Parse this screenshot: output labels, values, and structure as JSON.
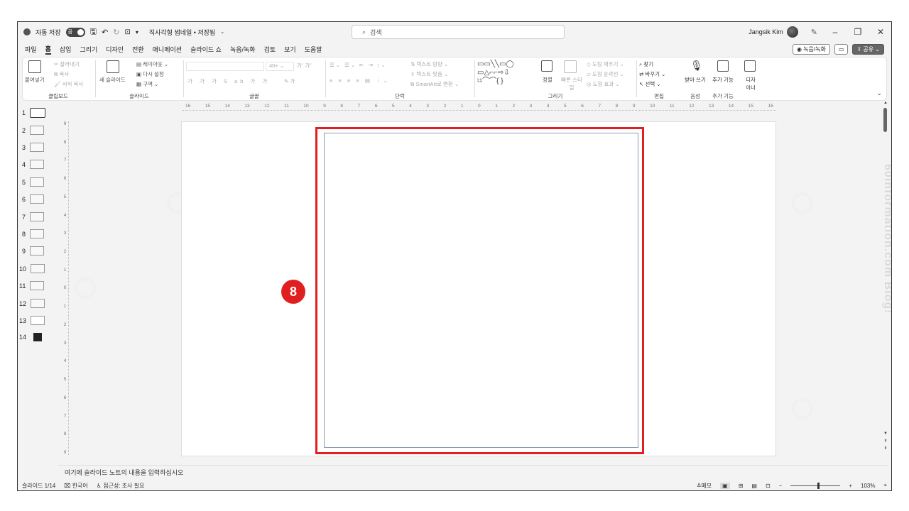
{
  "titlebar": {
    "autosave_label": "자동 저장",
    "toggle_state": "끔",
    "doc_title": "직사각형 썸네일 • 저장됨",
    "search_placeholder": "검색",
    "user_name": "Jangsik Kim"
  },
  "menu": {
    "tabs": [
      "파일",
      "홈",
      "삽입",
      "그리기",
      "디자인",
      "전환",
      "애니메이션",
      "슬라이드 쇼",
      "녹음/녹화",
      "검토",
      "보기",
      "도움말"
    ],
    "active_tab": "홈",
    "record_button": "녹음/녹화",
    "share_button": "공유"
  },
  "ribbon": {
    "clipboard": {
      "paste": "붙여넣기",
      "cut": "잘라내기",
      "copy": "복사",
      "format_painter": "서식 복사",
      "label": "클립보드"
    },
    "slides": {
      "new_slide": "새 슬라이드",
      "layout": "레이아웃",
      "reset": "다시 설정",
      "section": "구역",
      "label": "슬라이드"
    },
    "font": {
      "size": "40+",
      "label": "글꼴"
    },
    "paragraph": {
      "text_direction": "텍스트 방향",
      "align_text": "텍스트 맞춤",
      "smartart": "SmartArt로 변환",
      "label": "단락"
    },
    "drawing": {
      "arrange": "정렬",
      "quick_styles": "빠른 스타일",
      "shape_fill": "도형 채우기",
      "shape_outline": "도형 윤곽선",
      "shape_effects": "도형 효과",
      "label": "그리기"
    },
    "editing": {
      "find": "찾기",
      "replace": "바꾸기",
      "select": "선택",
      "label": "편집"
    },
    "voice": {
      "dictate": "받아 쓰기",
      "label": "음성"
    },
    "addins": {
      "addins": "추가 기능",
      "label": "추가 기능"
    },
    "designer": {
      "label": "디자 이너"
    }
  },
  "thumbnails": [
    "1",
    "2",
    "3",
    "4",
    "5",
    "6",
    "7",
    "8",
    "9",
    "10",
    "11",
    "12",
    "13",
    "14"
  ],
  "ruler": {
    "h_ticks": [
      "16",
      "15",
      "14",
      "13",
      "12",
      "11",
      "10",
      "9",
      "8",
      "7",
      "6",
      "5",
      "4",
      "3",
      "2",
      "1",
      "0",
      "1",
      "2",
      "3",
      "4",
      "5",
      "6",
      "7",
      "8",
      "9",
      "10",
      "11",
      "12",
      "13",
      "14",
      "15",
      "16"
    ],
    "v_ticks": [
      "9",
      "8",
      "7",
      "6",
      "5",
      "4",
      "3",
      "2",
      "1",
      "0",
      "1",
      "2",
      "3",
      "4",
      "5",
      "6",
      "7",
      "8",
      "9"
    ]
  },
  "slide": {
    "step_badge": "8"
  },
  "notes": {
    "placeholder": "여기에 슬라이드 노트의 내용을 입력하십시오"
  },
  "status": {
    "slide_counter": "슬라이드 1/14",
    "language": "한국어",
    "accessibility": "접근성: 조사 필요",
    "notes_button": "메모",
    "zoom": "103%"
  },
  "watermark": "60information.com Blog!"
}
